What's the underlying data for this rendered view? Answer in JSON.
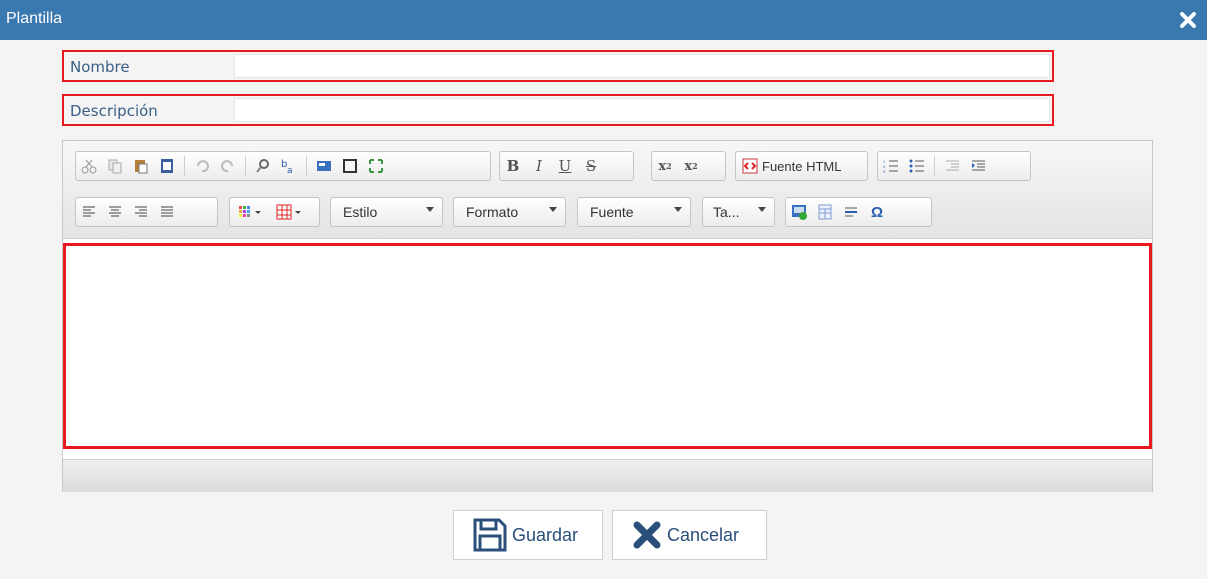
{
  "window": {
    "title": "Plantilla",
    "close_icon": "close-icon"
  },
  "form": {
    "nombre": {
      "label": "Nombre",
      "value": ""
    },
    "descripcion": {
      "label": "Descripción",
      "value": ""
    }
  },
  "toolbar": {
    "source_label": "Fuente HTML",
    "estilo": "Estilo",
    "formato": "Formato",
    "fuente": "Fuente",
    "tamano": "Ta..."
  },
  "editor_content": "",
  "buttons": {
    "save": "Guardar",
    "cancel": "Cancelar"
  },
  "colors": {
    "titlebar": "#3a78b0",
    "highlight": "#e8191f",
    "label": "#3a5f86"
  }
}
